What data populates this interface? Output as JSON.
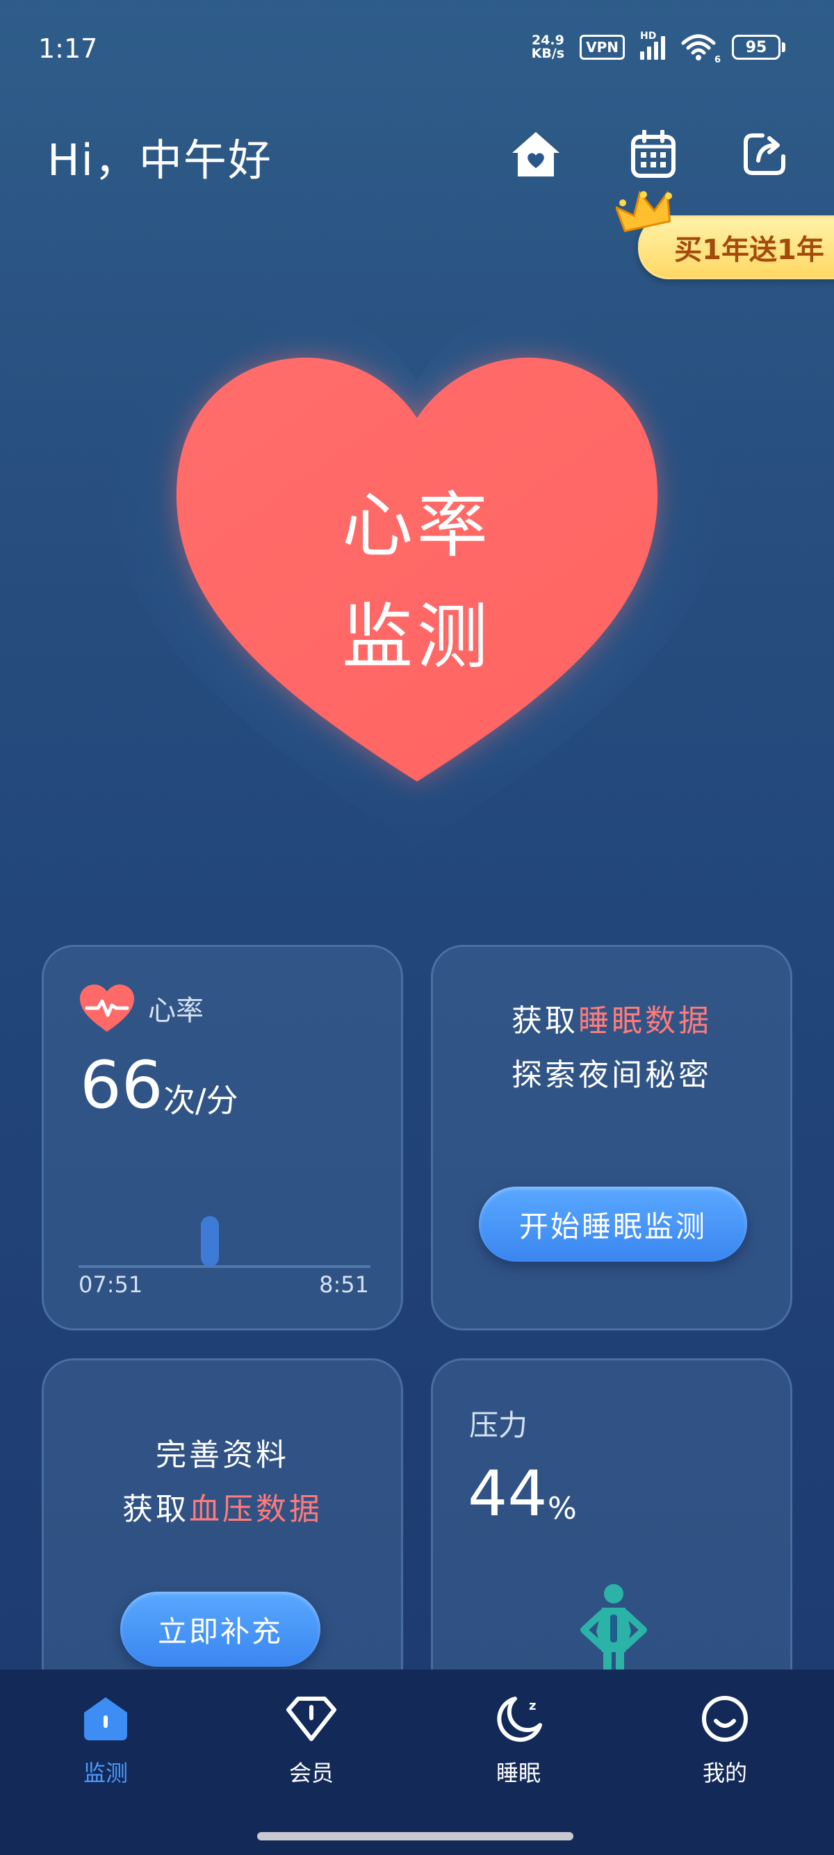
{
  "status_bar": {
    "time": "1:17",
    "net_speed_value": "24.9",
    "net_speed_unit": "KB/s",
    "vpn": "VPN",
    "hd": "HD",
    "wifi_sub": "6",
    "battery": "95"
  },
  "header": {
    "greeting": "Hi，中午好",
    "icons": [
      "home-icon",
      "calendar-icon",
      "share-icon"
    ]
  },
  "promo_badge": {
    "label": "买1年送1年"
  },
  "hero": {
    "line1": "心率",
    "line2": "监测"
  },
  "heart_rate_card": {
    "label": "心率",
    "value": "66",
    "unit": "次/分",
    "axis_start": "07:51",
    "axis_end": "8:51",
    "chart_data": {
      "type": "bar",
      "x_range": [
        "07:51",
        "8:51"
      ],
      "points": [
        {
          "time": "08:18",
          "value": 66
        }
      ]
    }
  },
  "sleep_card": {
    "line1_prefix": "获取",
    "line1_highlight": "睡眠数据",
    "line2": "探索夜间秘密",
    "button": "开始睡眠监测"
  },
  "bp_card": {
    "line1": "完善资料",
    "line2_prefix": "获取",
    "line2_highlight": "血压数据",
    "button": "立即补充"
  },
  "stress_card": {
    "label": "压力",
    "value": "44",
    "unit": "%"
  },
  "tabbar": {
    "tabs": [
      {
        "label": "监测",
        "icon": "home-shield-icon",
        "active": true
      },
      {
        "label": "会员",
        "icon": "diamond-icon",
        "active": false
      },
      {
        "label": "睡眠",
        "icon": "moon-icon",
        "active": false
      },
      {
        "label": "我的",
        "icon": "smile-icon",
        "active": false
      }
    ]
  },
  "colors": {
    "accent": "#4d9bff",
    "heart": "#ff6b68",
    "highlight_text": "#ff7b7b",
    "teal_figure": "#2bb3a8"
  }
}
